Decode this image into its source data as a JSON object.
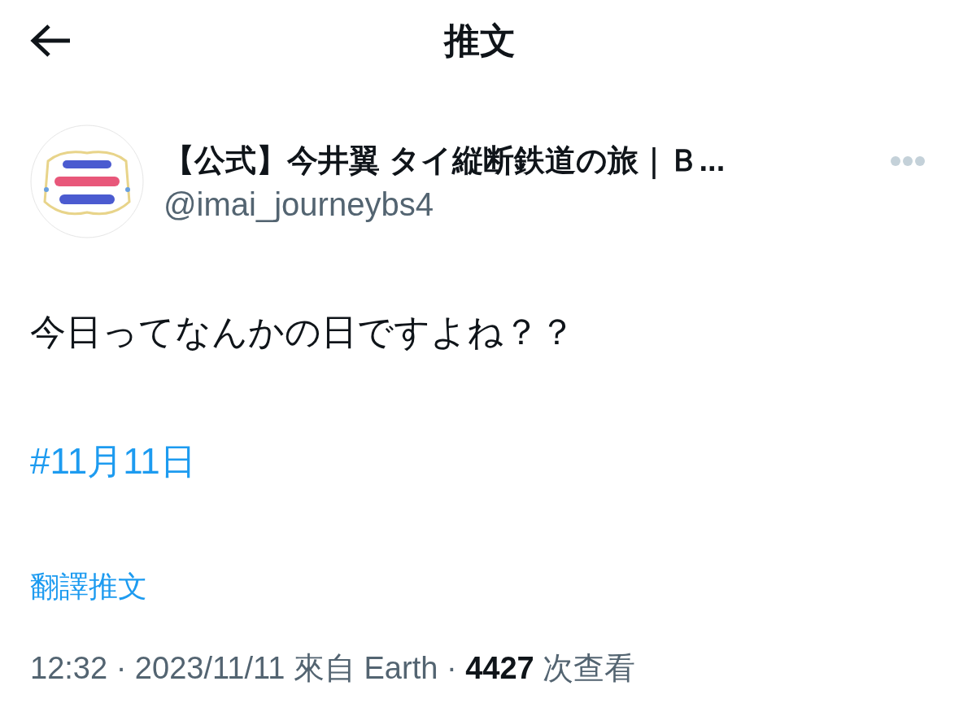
{
  "header": {
    "title": "推文"
  },
  "author": {
    "name": "【公式】今井翼 タイ縦断鉄道の旅｜Ｂ...",
    "handle": "@imai_journeybs4"
  },
  "tweet": {
    "text": "今日ってなんかの日ですよね？？",
    "hashtag": "#11月11日",
    "translate": "翻譯推文",
    "meta": "12:32 · 2023/11/11 來自 Earth · **4427** 次查看"
  }
}
